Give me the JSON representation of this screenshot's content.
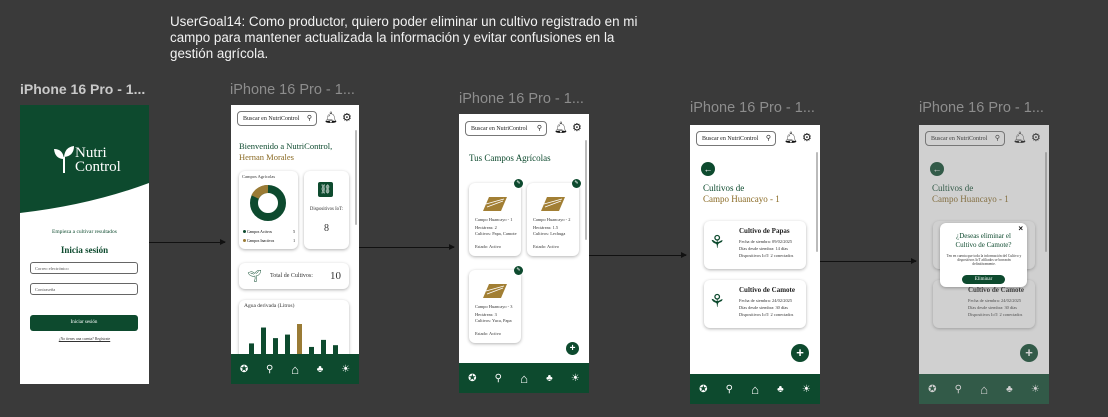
{
  "user_goal": "UserGoal14: Como productor, quiero poder eliminar un cultivo registrado en mi campo para mantener actualizada la información y evitar confusiones en la gestión agrícola.",
  "frames": [
    {
      "title": "iPhone 16 Pro - 1..."
    },
    {
      "title": "iPhone 16 Pro - 1..."
    },
    {
      "title": "iPhone 16 Pro - 1..."
    },
    {
      "title": "iPhone 16 Pro - 1..."
    },
    {
      "title": "iPhone 16 Pro - 1..."
    }
  ],
  "login": {
    "logo_line1": "Nutri",
    "logo_line2": "Control",
    "tagline": "Empieza a cultivar resultados",
    "heading": "Inicia sesión",
    "email_placeholder": "Correo electrónico",
    "password_placeholder": "Contraseña",
    "login_button": "Iniciar sesión",
    "register_link": "¿No tienes una cuenta? Regístrate"
  },
  "search": {
    "placeholder": "Buscar en NutriControl"
  },
  "dashboard": {
    "welcome": "Bienvenido a NutriControl,",
    "user_name": "Hernan Morales",
    "fields_card_title": "Campos Agrícolas",
    "active_label": "Campos Activos",
    "active_count": "5",
    "inactive_label": "Campos Inactivos",
    "inactive_count": "1",
    "iot_label": "Dispositivos IoT:",
    "iot_count": "8",
    "crops_label": "Total de Cultivos:",
    "crops_count": "10",
    "water_title": "Agua derivada (Litros)",
    "water_bars": [
      12,
      30,
      18,
      22,
      34,
      8,
      16,
      10
    ]
  },
  "fields_screen": {
    "title": "Tus Campos Agrícolas",
    "fields": [
      {
        "name": "Campo Huancayo - 1",
        "crops": "Hectáreas: 2",
        "line2": "Cultivos: Papa, Camote",
        "status": "Estado: Activo"
      },
      {
        "name": "Campo Huancayo - 2",
        "crops": "Hectáreas: 1.5",
        "line2": "Cultivos: Lechuga",
        "status": "Estado: Activo"
      },
      {
        "name": "Campo Huancayo - 3",
        "crops": "Hectáreas: 3",
        "line2": "Cultivos: Yuca, Papa",
        "status": "Estado: Activo"
      }
    ]
  },
  "crops_screen": {
    "title_line1": "Cultivos de",
    "title_line2": "Campo Huancayo - 1",
    "crops": [
      {
        "name": "Cultivo de Papas",
        "date": "Fecha de siembra: 09/02/2025",
        "days": "Días desde siembra: 14 días",
        "devices": "Dispositivos IoT: 2 conectados"
      },
      {
        "name": "Cultivo de Camote",
        "date": "Fecha de siembra: 24/02/2025",
        "days": "Días desde siembra: 30 días",
        "devices": "Dispositivos IoT: 2 conectados"
      }
    ]
  },
  "delete_dialog": {
    "question_line1": "¿Deseas eliminar el",
    "question_line2": "Cultivo de Camote?",
    "warning": "Ten en cuenta que toda la información del Cultivo y dispositivos IoT afiliados se borrarán definitivamente.",
    "confirm_button": "Eliminar",
    "close": "×"
  },
  "colors": {
    "brand_green": "#0d4a2e",
    "gold": "#8a6a24",
    "background": "#3a3a3a"
  }
}
